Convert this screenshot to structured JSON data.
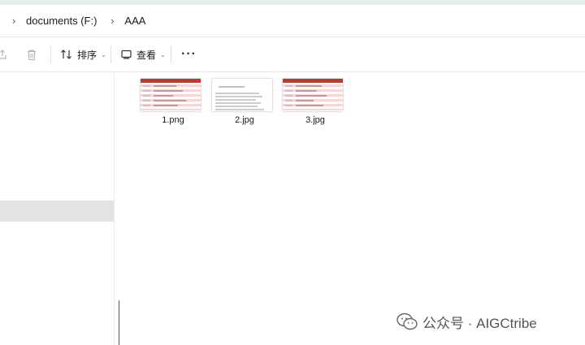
{
  "breadcrumb": {
    "drive": "documents (F:)",
    "folder": "AAA"
  },
  "toolbar": {
    "sort_label": "排序",
    "view_label": "查看",
    "more_label": "···"
  },
  "files": [
    {
      "name": "1.png",
      "thumb": "table-red"
    },
    {
      "name": "2.jpg",
      "thumb": "text-doc"
    },
    {
      "name": "3.jpg",
      "thumb": "table-red"
    }
  ],
  "watermark": {
    "text": "公众号 · AIGCtribe"
  },
  "colors": {
    "thumb_accent": "#c0392b",
    "thumb_row": "#f4d6d6",
    "selection": "#e3e3e3"
  }
}
